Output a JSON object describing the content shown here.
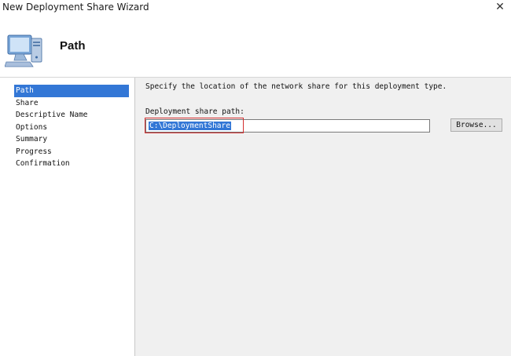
{
  "window": {
    "title": "New Deployment Share Wizard",
    "close_glyph": "✕"
  },
  "header": {
    "icon": "computer-icon",
    "title": "Path"
  },
  "nav": {
    "selected_index": 0,
    "items": [
      {
        "label": "Path"
      },
      {
        "label": "Share"
      },
      {
        "label": "Descriptive Name"
      },
      {
        "label": "Options"
      },
      {
        "label": "Summary"
      },
      {
        "label": "Progress"
      },
      {
        "label": "Confirmation"
      }
    ]
  },
  "main": {
    "instructions": "Specify the location of the network share for this deployment type.",
    "path_label": "Deployment share path:",
    "path_value": "C:\\DeploymentShare",
    "browse_label": "Browse..."
  },
  "colors": {
    "selection": "#3377d6",
    "highlight_box": "#d32f2f",
    "content_bg": "#f0f0f0"
  }
}
